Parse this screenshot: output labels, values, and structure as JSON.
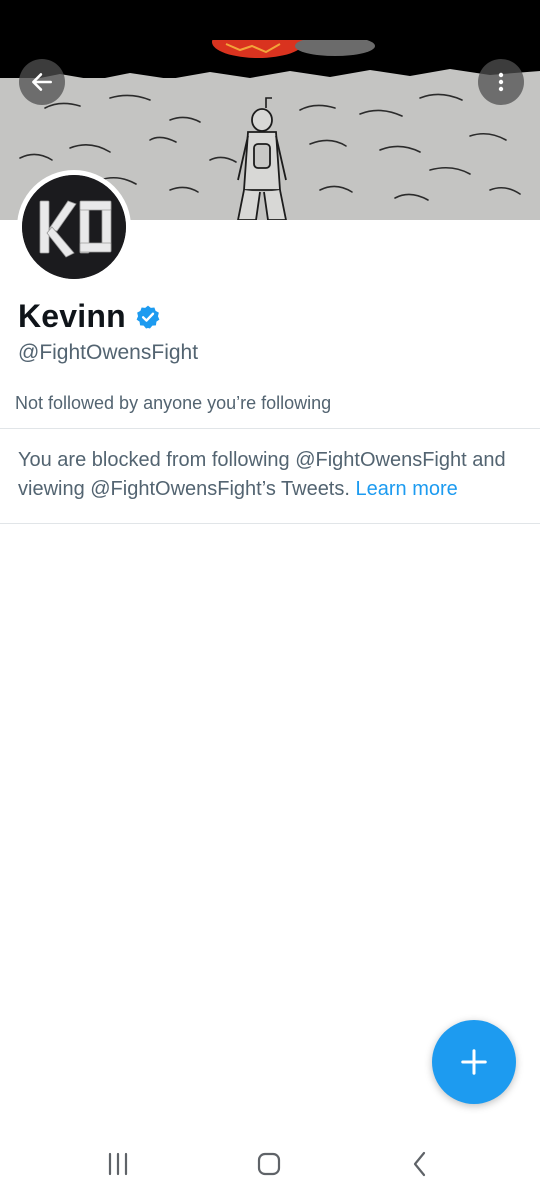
{
  "profile": {
    "display_name": "Kevinn",
    "handle": "@FightOwensFight",
    "avatar_text": "KO",
    "followers_you_follow": "Not followed by anyone you’re following"
  },
  "blocked": {
    "message": "You are blocked from following @FightOwensFight and viewing @FightOwensFight’s Tweets.",
    "link_label": "Learn more"
  },
  "icons": {
    "back": "arrow-left-icon",
    "more": "more-vertical-icon",
    "verified": "verified-badge-icon",
    "compose": "plus-icon",
    "nav_recents": "recents-icon",
    "nav_home": "home-icon",
    "nav_back": "back-chevron-icon"
  },
  "colors": {
    "accent": "#1d9bf0",
    "text_primary": "#0f1419",
    "text_secondary": "#536471"
  }
}
